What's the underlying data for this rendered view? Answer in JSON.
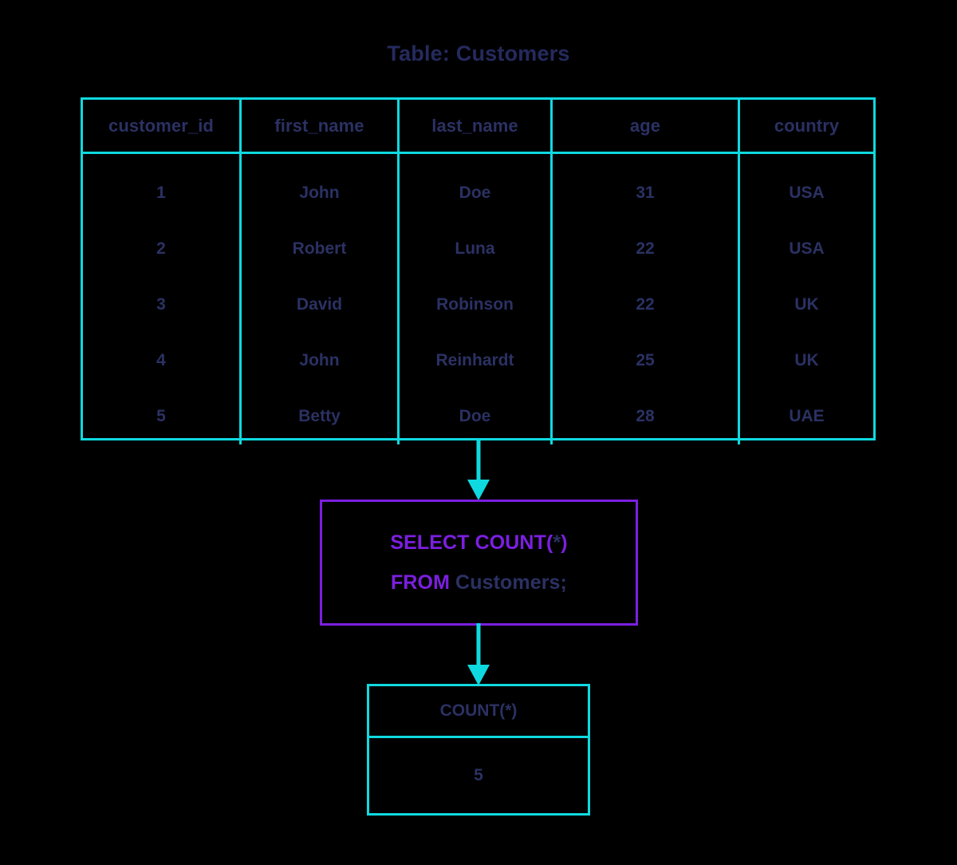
{
  "title": "Table: Customers",
  "colors": {
    "background": "#000000",
    "table_border": "#0fd9e0",
    "text_navy": "#2b3163",
    "keyword_purple": "#7b1fe0",
    "arrow": "#0fd9e0"
  },
  "customers_table": {
    "name": "Customers",
    "columns": [
      "customer_id",
      "first_name",
      "last_name",
      "age",
      "country"
    ],
    "rows": [
      [
        "1",
        "John",
        "Doe",
        "31",
        "USA"
      ],
      [
        "2",
        "Robert",
        "Luna",
        "22",
        "USA"
      ],
      [
        "3",
        "David",
        "Robinson",
        "22",
        "UK"
      ],
      [
        "4",
        "John",
        "Reinhardt",
        "25",
        "UK"
      ],
      [
        "5",
        "Betty",
        "Doe",
        "28",
        "UAE"
      ]
    ]
  },
  "query": {
    "line1": {
      "keyword": "SELECT COUNT",
      "open_paren": "(",
      "star": "*",
      "close_paren": ")"
    },
    "line2": {
      "keyword": "FROM",
      "identifier": " Customers;"
    },
    "full_text": "SELECT COUNT(*) FROM Customers;"
  },
  "result_table": {
    "header": "COUNT(*)",
    "value": "5"
  },
  "arrows": [
    {
      "name": "table-to-query",
      "direction": "down"
    },
    {
      "name": "query-to-result",
      "direction": "down"
    }
  ]
}
